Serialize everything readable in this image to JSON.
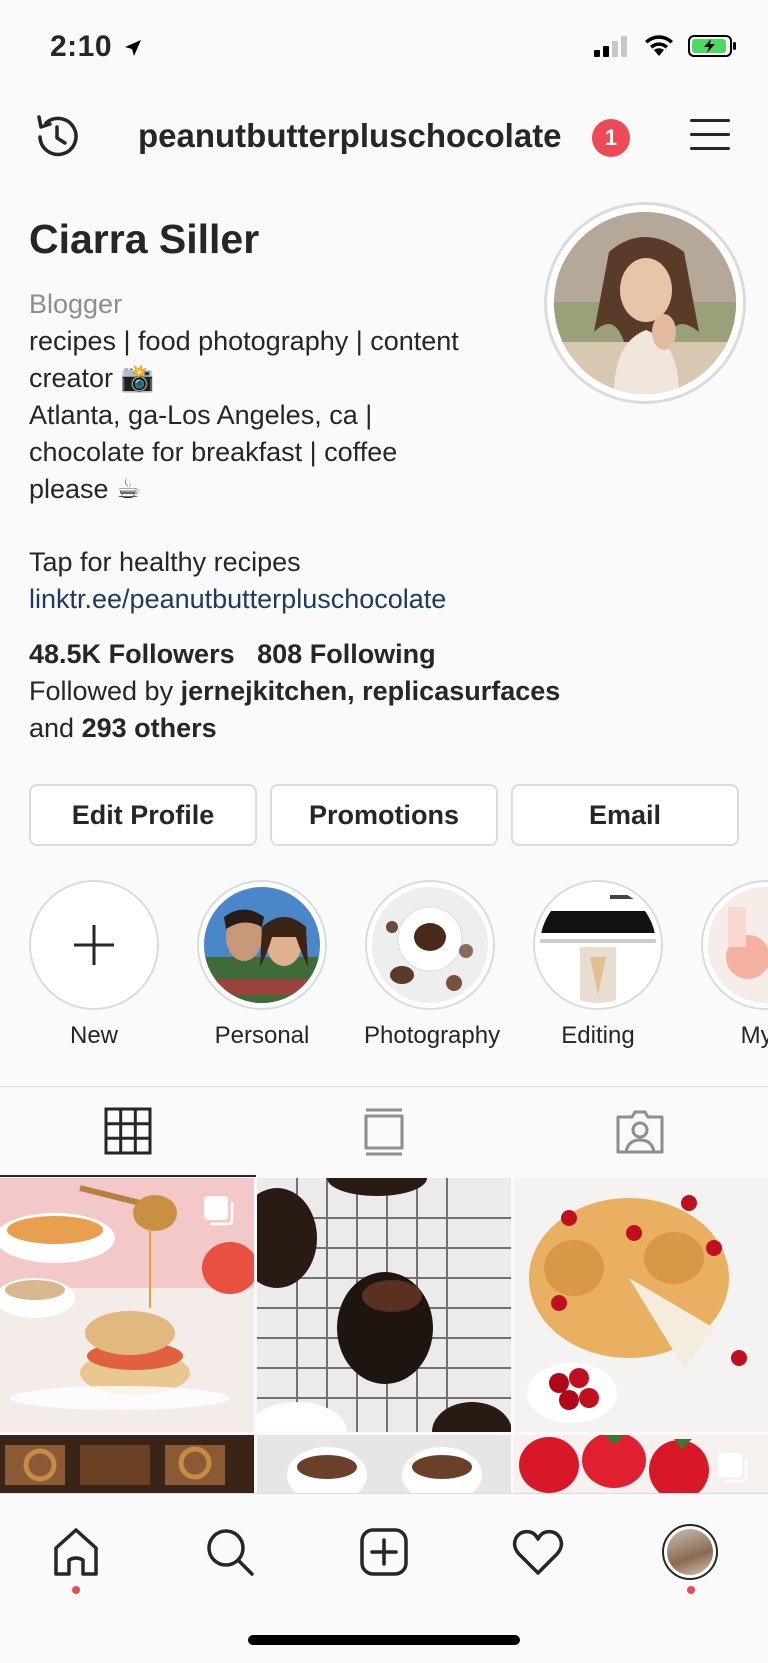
{
  "status_bar": {
    "time": "2:10"
  },
  "header": {
    "username": "peanutbutterpluschocolate",
    "notification_count": "1"
  },
  "profile": {
    "name": "Ciarra Siller",
    "category": "Blogger",
    "bio_lines": [
      "recipes | food photography | content",
      "creator 📸",
      "Atlanta, ga-Los Angeles, ca |",
      "chocolate for breakfast | coffee",
      "please ☕"
    ],
    "cta": "Tap for healthy recipes",
    "link": "linktr.ee/peanutbutterpluschocolate"
  },
  "stats": {
    "followers_count": "48.5K",
    "followers_label": "Followers",
    "following_count": "808",
    "following_label": "Following",
    "followed_by_prefix": "Followed by",
    "followed_by_users": "jernejkitchen, replicasurfaces",
    "and_label": "and",
    "others": "293 others"
  },
  "buttons": {
    "edit_profile": "Edit Profile",
    "promotions": "Promotions",
    "email": "Email"
  },
  "highlights": [
    {
      "label": "New"
    },
    {
      "label": "Personal"
    },
    {
      "label": "Photography"
    },
    {
      "label": "Editing"
    },
    {
      "label": "My s"
    }
  ],
  "colors": {
    "accent_red": "#ed4956",
    "link_blue": "#1f3a60",
    "border": "#dbdbdb"
  },
  "icons": {
    "header_left": "history-icon",
    "header_right": "hamburger-menu-icon",
    "tabs": [
      "grid-icon",
      "feed-icon",
      "tagged-icon"
    ],
    "nav": [
      "home-icon",
      "search-icon",
      "add-post-icon",
      "heart-icon",
      "profile-avatar-icon"
    ]
  }
}
